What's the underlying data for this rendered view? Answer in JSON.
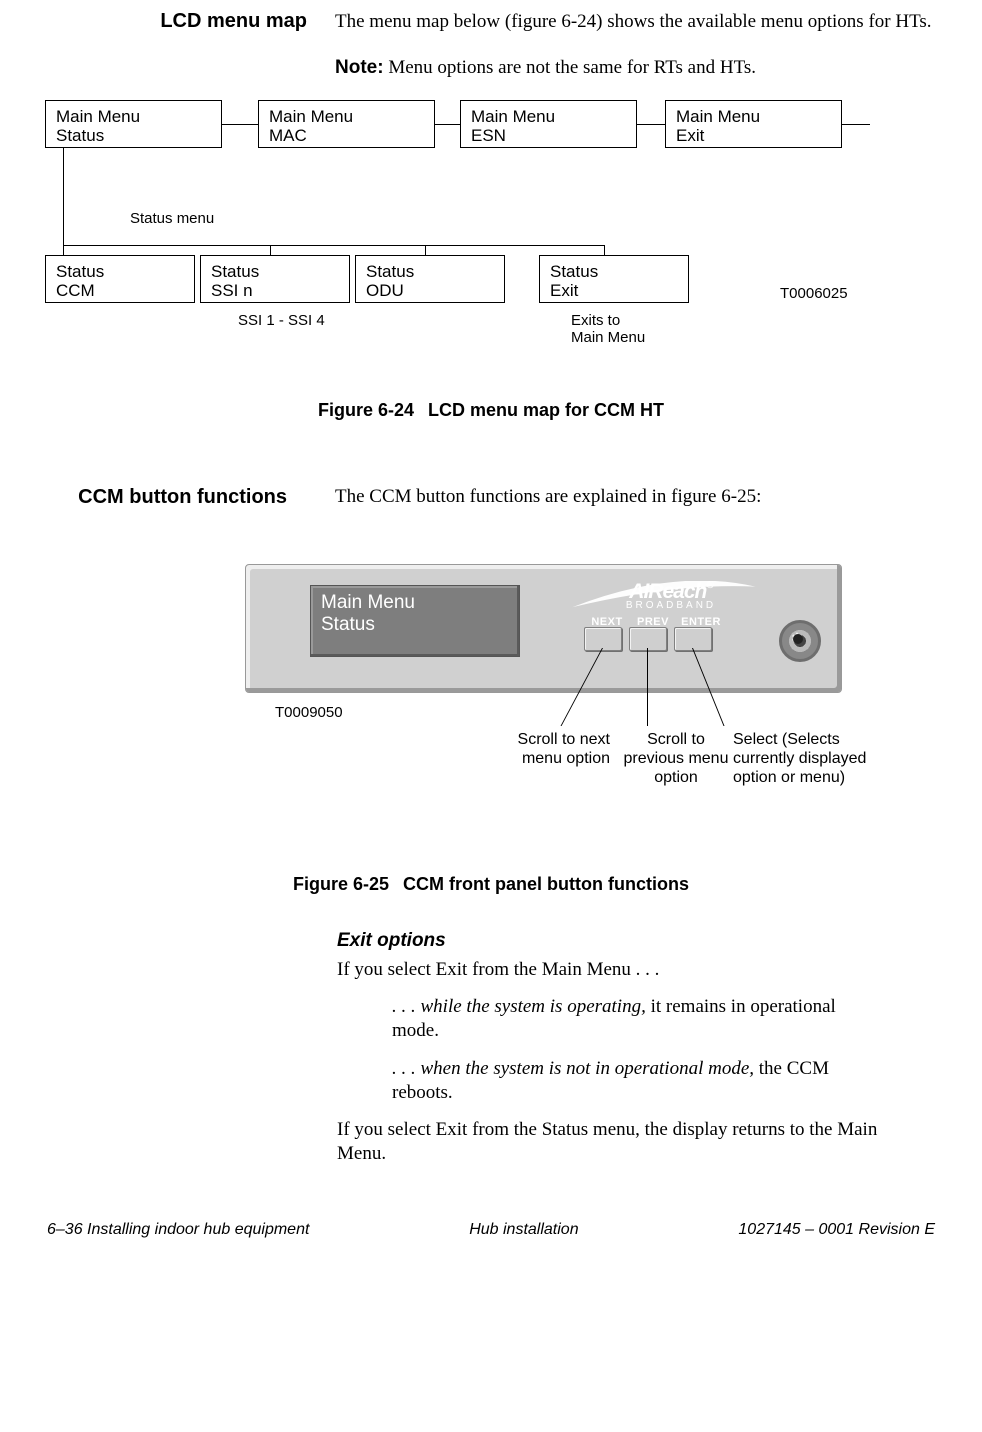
{
  "section1": {
    "heading": "LCD menu map",
    "intro": "The menu map below (figure 6-24) shows the available menu options for HTs.",
    "note_label": "Note:",
    "note_text": " Menu options are not the same for RTs and HTs."
  },
  "diagram1": {
    "main": [
      {
        "l1": "Main Menu",
        "l2": "Status"
      },
      {
        "l1": "Main Menu",
        "l2": "MAC"
      },
      {
        "l1": "Main Menu",
        "l2": "ESN"
      },
      {
        "l1": "Main Menu",
        "l2": "Exit"
      }
    ],
    "status": [
      {
        "l1": "Status",
        "l2": "CCM"
      },
      {
        "l1": "Status",
        "l2": "SSI n"
      },
      {
        "l1": "Status",
        "l2": "ODU"
      },
      {
        "l1": "Status",
        "l2": "Exit"
      }
    ],
    "status_menu_label": "Status menu",
    "ssi_label": "SSI 1 - SSI 4",
    "exits_label": "Exits to\nMain Menu",
    "tnum": "T0006025",
    "caption_num": "Figure  6-24",
    "caption_text": "LCD menu map for CCM HT"
  },
  "section2": {
    "heading": "CCM button functions",
    "intro": "The CCM button functions are explained in figure 6-25:"
  },
  "panel": {
    "lcd_l1": "Main Menu",
    "lcd_l2": "Status",
    "logo_main": "AIReach",
    "logo_reg": "®",
    "logo_sub": "BROADBAND",
    "btn_next": "NEXT",
    "btn_prev": "PREV",
    "btn_enter": "ENTER",
    "tnum": "T0009050",
    "callout_next": "Scroll to next menu option",
    "callout_prev": "Scroll to previous menu option",
    "callout_enter": "Select (Selects currently displayed option or menu)",
    "caption_num": "Figure  6-25",
    "caption_text": "CCM front panel button functions"
  },
  "exit": {
    "heading": "Exit options",
    "p1": "If you select Exit from the Main Menu . . .",
    "p2a": ". . . while the system is operating,",
    "p2b": " it remains in operational mode.",
    "p3a": ". . . when the system is not in operational mode,",
    "p3b": " the CCM reboots.",
    "p4": "If you select Exit from the Status menu, the display returns to the Main Menu."
  },
  "footer": {
    "left": "6–36  Installing indoor hub equipment",
    "center": "Hub installation",
    "right": "1027145 – 0001   Revision E"
  }
}
